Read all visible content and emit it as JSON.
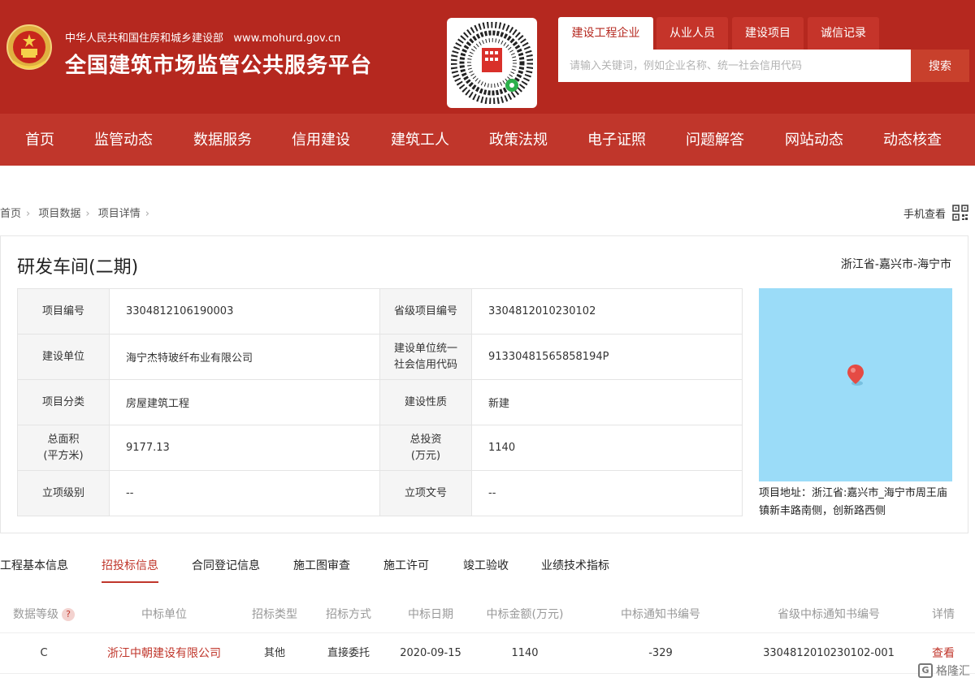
{
  "header": {
    "subtitle": "中华人民共和国住房和城乡建设部",
    "website": "www.mohurd.gov.cn",
    "title": "全国建筑市场监管公共服务平台",
    "emblem_icon": "national-emblem-icon",
    "qr_icon": "mini-program-qr-icon"
  },
  "search": {
    "tabs": [
      "建设工程企业",
      "从业人员",
      "建设项目",
      "诚信记录"
    ],
    "active_tab": 0,
    "placeholder": "请输入关键词，例如企业名称、统一社会信用代码",
    "button": "搜索"
  },
  "nav": {
    "items": [
      "首页",
      "监管动态",
      "数据服务",
      "信用建设",
      "建筑工人",
      "政策法规",
      "电子证照",
      "问题解答",
      "网站动态",
      "动态核查"
    ]
  },
  "breadcrumb": {
    "items": [
      "首页",
      "项目数据",
      "项目详情"
    ],
    "mobile_view": "手机查看"
  },
  "project": {
    "title": "研发车间(二期)",
    "region": "浙江省-嘉兴市-海宁市",
    "fields": {
      "project_no_label": "项目编号",
      "project_no": "3304812106190003",
      "provincial_no_label": "省级项目编号",
      "provincial_no": "3304812010230102",
      "builder_label": "建设单位",
      "builder": "海宁杰特玻纤布业有限公司",
      "credit_code_label_1": "建设单位统一",
      "credit_code_label_2": "社会信用代码",
      "credit_code": "91330481565858194P",
      "category_label": "项目分类",
      "category": "房屋建筑工程",
      "nature_label": "建设性质",
      "nature": "新建",
      "area_label_1": "总面积",
      "area_label_2": "(平方米)",
      "area": "9177.13",
      "investment_label_1": "总投资",
      "investment_label_2": "(万元)",
      "investment": "1140",
      "approval_level_label": "立项级别",
      "approval_level": "--",
      "approval_doc_label": "立项文号",
      "approval_doc": "--"
    },
    "map_pin_icon": "map-pin-icon",
    "map_color": "#9bdcf8",
    "address_label": "项目地址：",
    "address": "浙江省:嘉兴市_海宁市周王庙镇新丰路南侧，创新路西侧"
  },
  "tabs": {
    "items": [
      "工程基本信息",
      "招投标信息",
      "合同登记信息",
      "施工图审查",
      "施工许可",
      "竣工验收",
      "业绩技术指标"
    ],
    "active": 1
  },
  "bids": {
    "headers": [
      "数据等级",
      "中标单位",
      "招标类型",
      "招标方式",
      "中标日期",
      "中标金额(万元)",
      "中标通知书编号",
      "省级中标通知书编号",
      "详情"
    ],
    "help_mark": "?",
    "rows": [
      {
        "level": "C",
        "winner": "浙江中朝建设有限公司",
        "type": "其他",
        "method": "直接委托",
        "date": "2020-09-15",
        "amount": "1140",
        "notice_no": "-329",
        "provincial_notice_no": "3304812010230102-001",
        "detail": "查看"
      }
    ]
  },
  "watermark": {
    "text": "格隆汇",
    "mark": "G"
  },
  "colors": {
    "brand_red": "#b5281f",
    "nav_red": "#c0362b",
    "link_red": "#c0362b"
  }
}
